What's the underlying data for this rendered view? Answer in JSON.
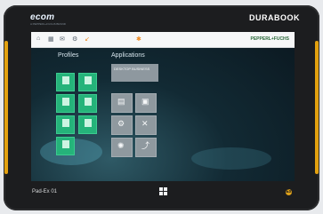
{
  "device": {
    "brand_top_left": "ecom",
    "brand_top_left_sub": "A PEPPERL+FUCHS BRAND",
    "brand_top_right": "DURABOOK",
    "model_label": "Pad-Ex 01",
    "ex_mark": "Ex"
  },
  "topbar": {
    "icons": [
      "home-icon",
      "grid-icon",
      "mail-icon",
      "gear-icon",
      "arrow-icon",
      "indicator-icon"
    ],
    "logo_text": "PEPPERL+FUCHS"
  },
  "profiles": {
    "title": "Profiles",
    "tiles": [
      {
        "label": ""
      },
      {
        "label": ""
      },
      {
        "label": ""
      },
      {
        "label": ""
      },
      {
        "label": ""
      },
      {
        "label": ""
      },
      {
        "label": ""
      },
      {
        "label": ""
      }
    ]
  },
  "applications": {
    "title": "Applications",
    "banner_label": "DESKTOP BUSINESS",
    "tiles": [
      {
        "icon": "document-icon",
        "label": ""
      },
      {
        "icon": "window-icon",
        "label": ""
      },
      {
        "icon": "gear-icon",
        "label": ""
      },
      {
        "icon": "tools-icon",
        "label": ""
      },
      {
        "icon": "gear-alt-icon",
        "label": ""
      },
      {
        "icon": "curve-icon",
        "label": ""
      }
    ]
  },
  "colors": {
    "accent_orange": "#e3a10f",
    "tile_green": "#25b37a",
    "tile_gray": "#8f999f"
  }
}
